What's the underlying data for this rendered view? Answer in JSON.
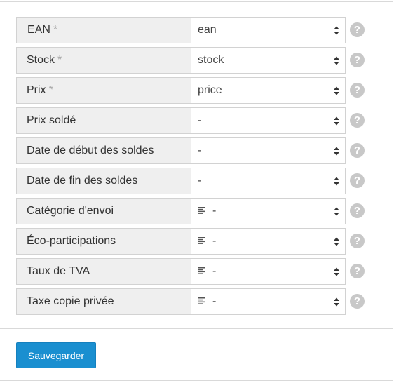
{
  "fields": [
    {
      "label": "EAN",
      "required": "*",
      "value": "ean",
      "list_icon": false
    },
    {
      "label": "Stock",
      "required": "*",
      "value": "stock",
      "list_icon": false
    },
    {
      "label": "Prix",
      "required": "*",
      "value": "price",
      "list_icon": false
    },
    {
      "label": "Prix soldé",
      "required": "",
      "value": "-",
      "list_icon": false
    },
    {
      "label": "Date de début des soldes",
      "required": "",
      "value": "-",
      "list_icon": false
    },
    {
      "label": "Date de fin des soldes",
      "required": "",
      "value": "-",
      "list_icon": false
    },
    {
      "label": "Catégorie d'envoi",
      "required": "",
      "value": "-",
      "list_icon": true
    },
    {
      "label": "Éco-participations",
      "required": "",
      "value": "-",
      "list_icon": true
    },
    {
      "label": "Taux de TVA",
      "required": "",
      "value": "-",
      "list_icon": true
    },
    {
      "label": "Taxe copie privée",
      "required": "",
      "value": "-",
      "list_icon": true
    }
  ],
  "help_glyph": "?",
  "save_label": "Sauvegarder",
  "colors": {
    "button_bg": "#1a8fd0",
    "label_bg": "#efefef",
    "help_bg": "#c8c8c8"
  }
}
